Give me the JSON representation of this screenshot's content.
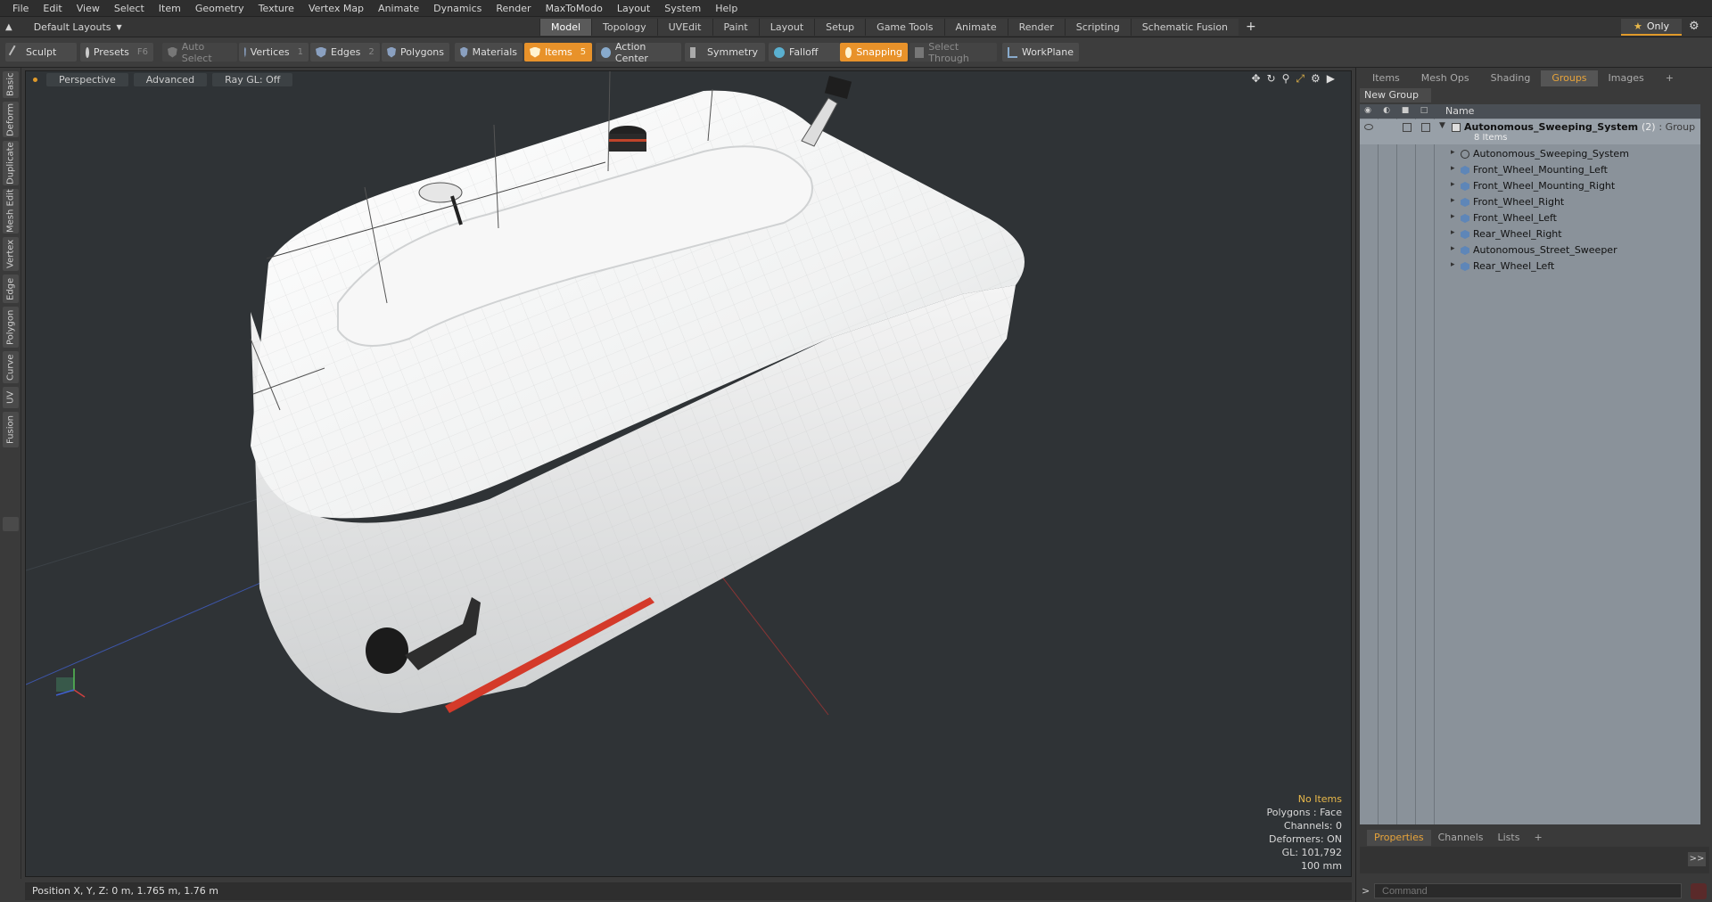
{
  "menu": [
    "File",
    "Edit",
    "View",
    "Select",
    "Item",
    "Geometry",
    "Texture",
    "Vertex Map",
    "Animate",
    "Dynamics",
    "Render",
    "MaxToModo",
    "Layout",
    "System",
    "Help"
  ],
  "layout_menu": "Default Layouts",
  "layout_tabs": [
    "Model",
    "Topology",
    "UVEdit",
    "Paint",
    "Layout",
    "Setup",
    "Game Tools",
    "Animate",
    "Render",
    "Scripting",
    "Schematic Fusion"
  ],
  "active_layout_tab": "Model",
  "only_label": "Only",
  "toolbar": {
    "sculpt": "Sculpt",
    "presets": "Presets",
    "presets_key": "F6",
    "auto_select": "Auto Select",
    "vertices": "Vertices",
    "vertices_key": "1",
    "edges": "Edges",
    "edges_key": "2",
    "polygons": "Polygons",
    "materials": "Materials",
    "items": "Items",
    "items_key": "5",
    "action_center": "Action Center",
    "symmetry": "Symmetry",
    "falloff": "Falloff",
    "snapping": "Snapping",
    "select_through": "Select Through",
    "workplane": "WorkPlane"
  },
  "left_tabs": [
    "Basic",
    "Deform",
    "Duplicate",
    "Mesh Edit",
    "Vertex",
    "Edge",
    "Polygon",
    "Curve",
    "UV",
    "Fusion"
  ],
  "viewport": {
    "view": "Perspective",
    "mode": "Advanced",
    "raygl": "Ray GL: Off",
    "info": {
      "no_items": "No Items",
      "polygons": "Polygons : Face",
      "channels": "Channels: 0",
      "deformers": "Deformers: ON",
      "gl": "GL: 101,792",
      "grid": "100 mm"
    }
  },
  "status": "Position X, Y, Z:   0 m, 1.765 m, 1.76 m",
  "right_panel": {
    "tabs": [
      "Items",
      "Mesh Ops",
      "Shading",
      "Groups",
      "Images"
    ],
    "active_tab": "Groups",
    "new_group": "New Group",
    "column_name": "Name",
    "group": {
      "name": "Autonomous_Sweeping_System",
      "count": "(2)",
      "type": ": Group",
      "items_label": "8 Items"
    },
    "children": [
      "Autonomous_Sweeping_System",
      "Front_Wheel_Mounting_Left",
      "Front_Wheel_Mounting_Right",
      "Front_Wheel_Right",
      "Front_Wheel_Left",
      "Rear_Wheel_Right",
      "Autonomous_Street_Sweeper",
      "Rear_Wheel_Left"
    ],
    "bottom_tabs": [
      "Properties",
      "Channels",
      "Lists"
    ],
    "active_bottom_tab": "Properties",
    "command_placeholder": "Command"
  },
  "colors": {
    "accent": "#e8922a",
    "viewport_bg": "#2f3336",
    "panel_bg": "#8a929a"
  }
}
